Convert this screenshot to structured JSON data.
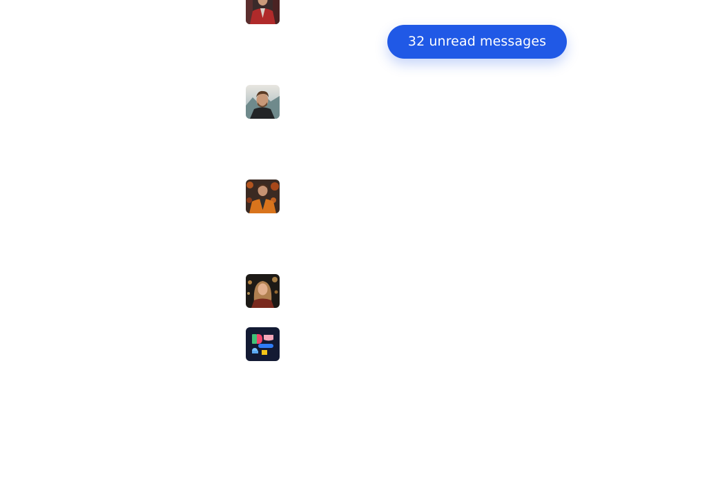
{
  "unread_banner": {
    "label": "32 unread messages",
    "color": "#2059e6"
  },
  "avatars": [
    {
      "icon": "person-avatar-icon"
    },
    {
      "icon": "person-avatar-icon"
    },
    {
      "icon": "person-avatar-icon"
    },
    {
      "icon": "person-avatar-icon"
    },
    {
      "icon": "app-logo-icon"
    }
  ]
}
